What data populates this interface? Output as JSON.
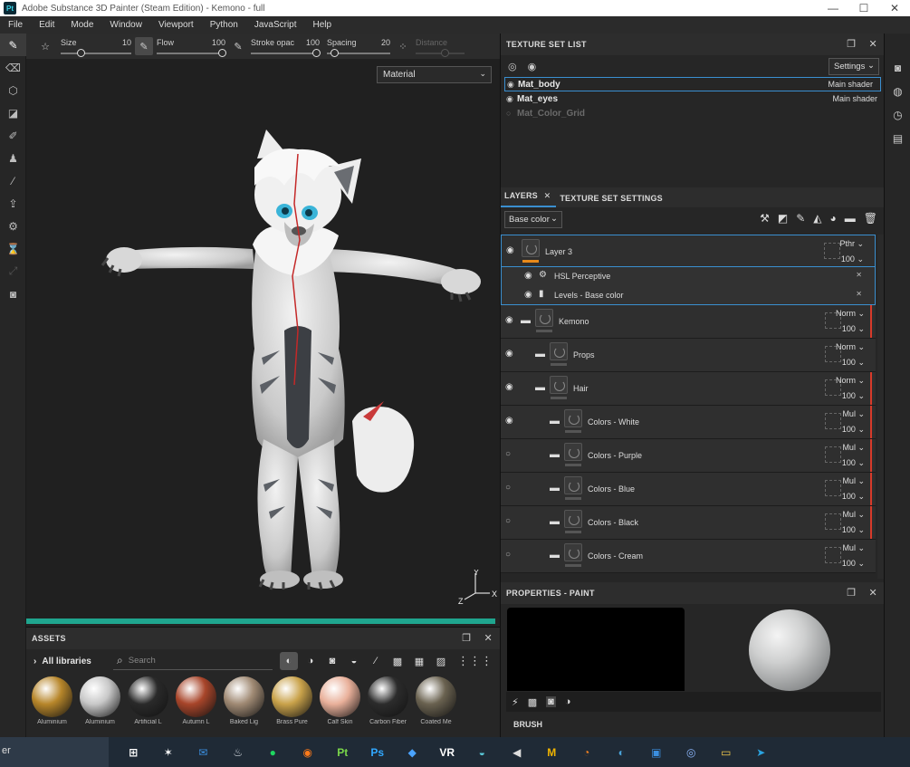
{
  "window": {
    "app_icon": "Pt",
    "title": "Adobe Substance 3D Painter (Steam Edition) - Kemono - full",
    "controls": [
      "—",
      "☐",
      "✕"
    ]
  },
  "menu": [
    "File",
    "Edit",
    "Mode",
    "Window",
    "Viewport",
    "Python",
    "JavaScript",
    "Help"
  ],
  "tool_options": {
    "size_label": "Size",
    "size_value": "10",
    "flow_label": "Flow",
    "flow_value": "100",
    "stroke_label": "Stroke opac",
    "stroke_value": "100",
    "spacing_label": "Spacing",
    "spacing_value": "20",
    "distance_label": "Distance"
  },
  "viewport": {
    "mode_select": "Material",
    "axis": {
      "x": "X",
      "y": "Y",
      "z": "Z"
    }
  },
  "assets": {
    "title": "ASSETS",
    "library": "All libraries",
    "search_placeholder": "Search",
    "items": [
      {
        "name": "Aluminium",
        "color": "#b7862a"
      },
      {
        "name": "Aluminium",
        "color": "#c8c8c8"
      },
      {
        "name": "Artificial L",
        "color": "#2a2a2a"
      },
      {
        "name": "Autumn L",
        "color": "#a8452a"
      },
      {
        "name": "Baked Lig",
        "color": "#a08a74"
      },
      {
        "name": "Brass Pure",
        "color": "#c9a24a"
      },
      {
        "name": "Calf Skin",
        "color": "#e9b09a"
      },
      {
        "name": "Carbon Fiber",
        "color": "#2c2c2c"
      },
      {
        "name": "Coated Me",
        "color": "#6a6250"
      }
    ]
  },
  "texture_set_list": {
    "title": "TEXTURE SET LIST",
    "settings_label": "Settings",
    "sets": [
      {
        "name": "Mat_body",
        "shader": "Main shader",
        "selected": true
      },
      {
        "name": "Mat_eyes",
        "shader": "Main shader",
        "selected": false
      },
      {
        "name": "Mat_Color_Grid",
        "shader": "",
        "selected": false
      }
    ]
  },
  "layers_panel": {
    "tab_layers": "LAYERS",
    "tab_settings": "TEXTURE SET SETTINGS",
    "channel": "Base color",
    "layers": [
      {
        "name": "Layer 3",
        "blend": "Pthr",
        "opacity": "100",
        "visible": true,
        "folder": false,
        "indent": 0,
        "selected": true,
        "effects": [
          "HSL Perceptive",
          "Levels - Base color"
        ]
      },
      {
        "name": "Kemono",
        "blend": "Norm",
        "opacity": "100",
        "visible": true,
        "folder": true,
        "indent": 0
      },
      {
        "name": "Props",
        "blend": "Norm",
        "opacity": "100",
        "visible": true,
        "folder": true,
        "indent": 1
      },
      {
        "name": "Hair",
        "blend": "Norm",
        "opacity": "100",
        "visible": true,
        "folder": true,
        "indent": 1
      },
      {
        "name": "Colors - White",
        "blend": "Mul",
        "opacity": "100",
        "visible": true,
        "folder": true,
        "indent": 2
      },
      {
        "name": "Colors - Purple",
        "blend": "Mul",
        "opacity": "100",
        "visible": false,
        "folder": true,
        "indent": 2
      },
      {
        "name": "Colors - Blue",
        "blend": "Mul",
        "opacity": "100",
        "visible": false,
        "folder": true,
        "indent": 2
      },
      {
        "name": "Colors - Black",
        "blend": "Mul",
        "opacity": "100",
        "visible": false,
        "folder": true,
        "indent": 2
      },
      {
        "name": "Colors - Cream",
        "blend": "Mul",
        "opacity": "100",
        "visible": false,
        "folder": true,
        "indent": 2
      }
    ]
  },
  "properties": {
    "title": "PROPERTIES - PAINT",
    "section": "BRUSH"
  },
  "taskbar": {
    "search_text": "er",
    "apps": [
      {
        "label": "⊞",
        "color": "#ffffff"
      },
      {
        "label": "✶",
        "color": "#ffffff"
      },
      {
        "label": "✉",
        "color": "#3b8fe0"
      },
      {
        "label": "♨",
        "color": "#cfd6dd"
      },
      {
        "label": "●",
        "color": "#1ed760"
      },
      {
        "label": "◉",
        "color": "#ff7a1a"
      },
      {
        "label": "Pt",
        "color": "#7ad64a"
      },
      {
        "label": "Ps",
        "color": "#31a8ff"
      },
      {
        "label": "◆",
        "color": "#4aa3ff"
      },
      {
        "label": "VR",
        "color": "#ffffff"
      },
      {
        "label": "◒",
        "color": "#5ac8d8"
      },
      {
        "label": "◀",
        "color": "#dddddd"
      },
      {
        "label": "M",
        "color": "#f0b400"
      },
      {
        "label": "◔",
        "color": "#f08020"
      },
      {
        "label": "◐",
        "color": "#4aa3d8"
      },
      {
        "label": "▣",
        "color": "#3b8fe0"
      },
      {
        "label": "◎",
        "color": "#8ab4f8"
      },
      {
        "label": "▭",
        "color": "#f2c94c"
      },
      {
        "label": "➤",
        "color": "#2aa3e0"
      }
    ]
  }
}
